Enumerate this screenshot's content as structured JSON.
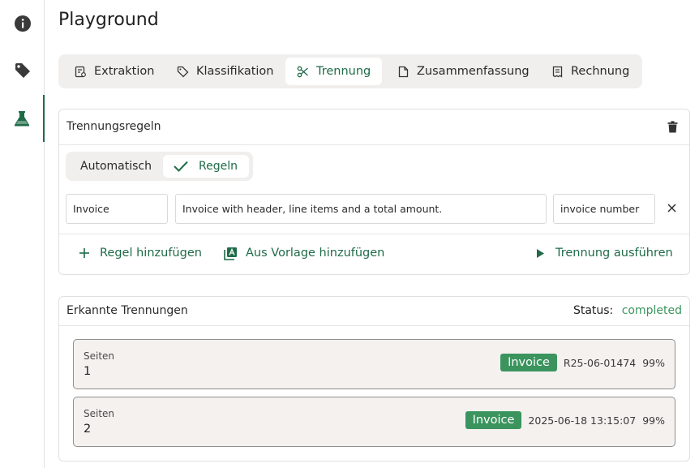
{
  "sidebar": {
    "items": [
      {
        "icon": "info-icon"
      },
      {
        "icon": "tag-icon"
      },
      {
        "icon": "flask-icon",
        "active": true
      }
    ]
  },
  "page": {
    "title": "Playground"
  },
  "tabs": [
    {
      "label": "Extraktion",
      "icon": "extraction-icon"
    },
    {
      "label": "Klassifikation",
      "icon": "tag-outline-icon"
    },
    {
      "label": "Trennung",
      "icon": "scissors-icon",
      "active": true
    },
    {
      "label": "Zusammenfassung",
      "icon": "document-icon"
    },
    {
      "label": "Rechnung",
      "icon": "receipt-icon"
    }
  ],
  "rules_card": {
    "title": "Trennungsregeln",
    "mode_options": [
      "Automatisch",
      "Regeln"
    ],
    "selected_mode": "Regeln",
    "rule": {
      "name": "Invoice",
      "description": "Invoice with header, line items and a total amount.",
      "key_field": "invoice number"
    },
    "actions": {
      "add_rule": "Regel hinzufügen",
      "add_from_template": "Aus Vorlage hinzufügen",
      "run": "Trennung ausführen"
    }
  },
  "results_card": {
    "title": "Erkannte Trennungen",
    "status_label": "Status:",
    "status_value": "completed",
    "items": [
      {
        "label": "Seiten",
        "pages": "1",
        "type": "Invoice",
        "identifier": "R25-06-01474",
        "confidence": "99%"
      },
      {
        "label": "Seiten",
        "pages": "2",
        "type": "Invoice",
        "identifier": "2025-06-18 13:15:07",
        "confidence": "99%"
      }
    ]
  },
  "colors": {
    "accent": "#1f6b48",
    "badge": "#3b945e",
    "status_ok": "#3b945e",
    "tab_bar_bg": "#f1efed"
  }
}
